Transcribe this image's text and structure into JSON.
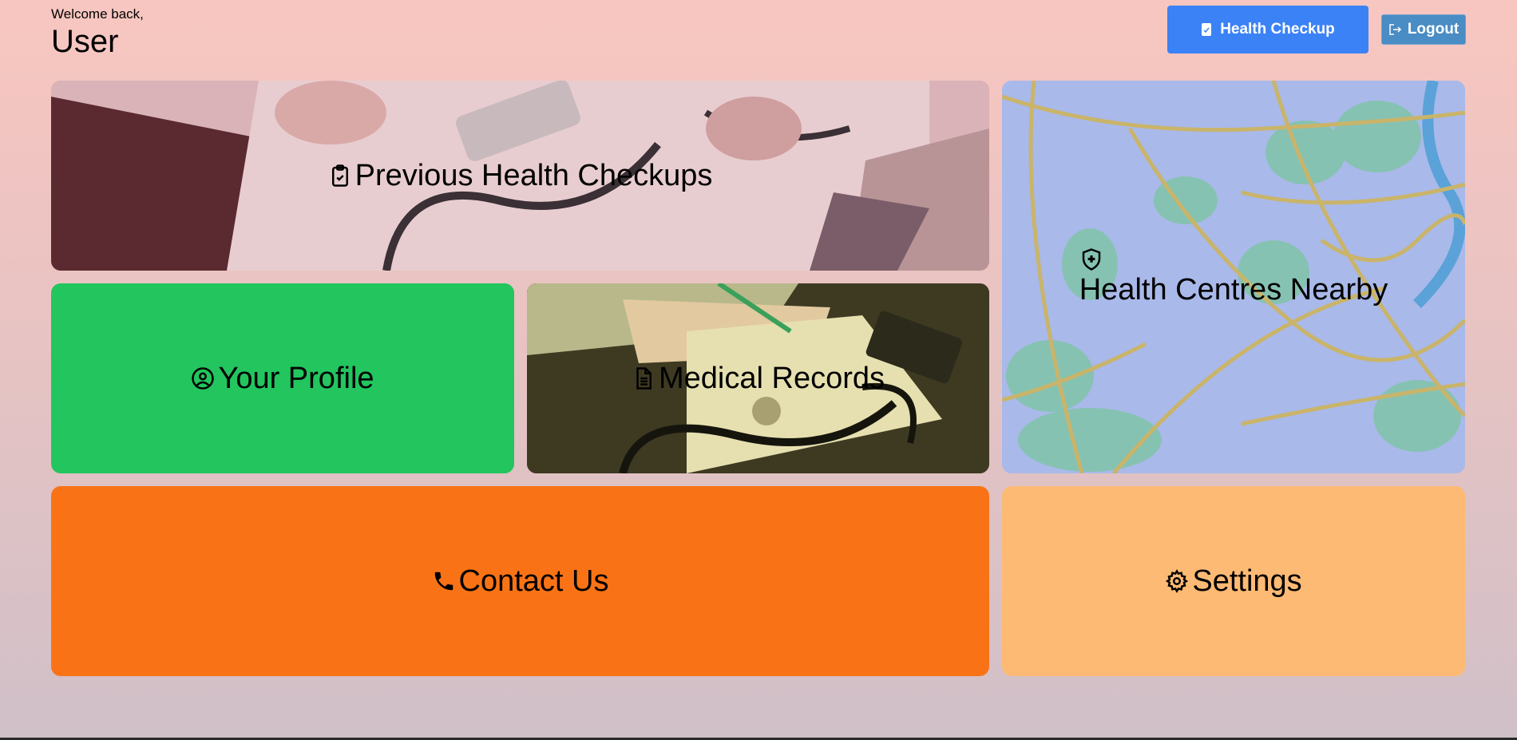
{
  "header": {
    "welcome": "Welcome back,",
    "username": "User",
    "checkup_button": "Health Checkup",
    "logout_button": "Logout"
  },
  "tiles": {
    "checkups": {
      "label": "Previous Health Checkups",
      "icon": "clipboard-check-icon"
    },
    "profile": {
      "label": "Your Profile",
      "icon": "user-circle-icon"
    },
    "records": {
      "label": "Medical Records",
      "icon": "document-icon"
    },
    "map": {
      "label": "Health Centres Nearby",
      "icon": "shield-plus-icon"
    },
    "contact": {
      "label": "Contact Us",
      "icon": "phone-icon"
    },
    "settings": {
      "label": "Settings",
      "icon": "gear-icon"
    }
  },
  "colors": {
    "primary_button": "#3b82f6",
    "profile": "#22c55e",
    "contact": "#f97316",
    "settings": "#fdba74"
  }
}
